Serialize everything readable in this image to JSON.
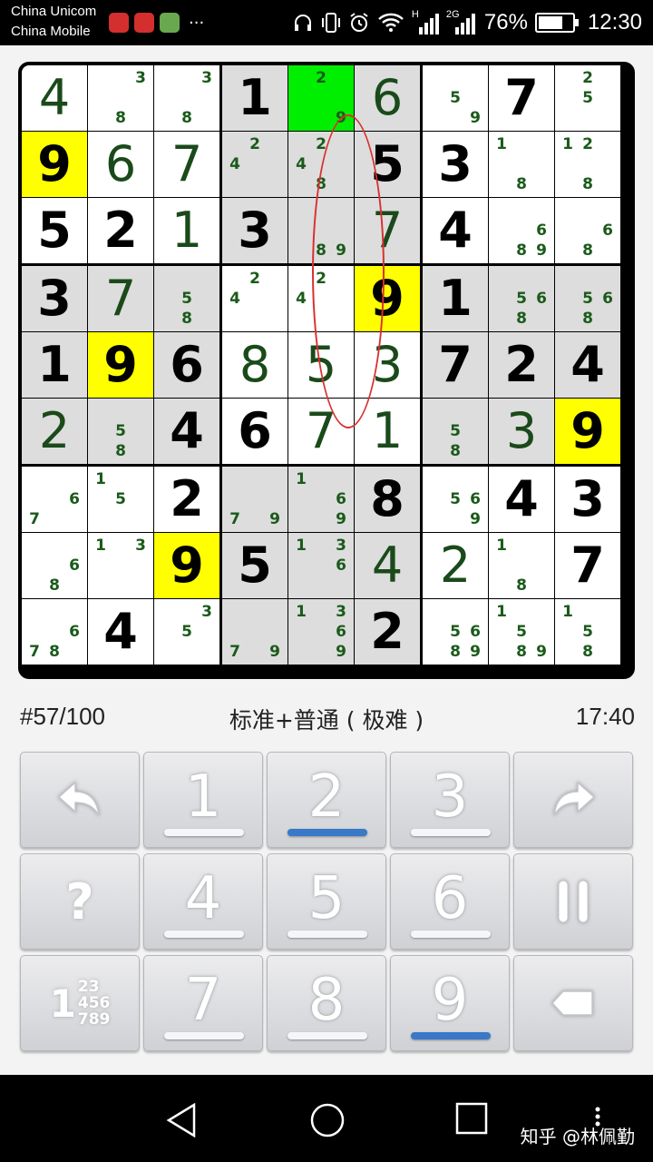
{
  "status_bar": {
    "carrier1": "China Unicom",
    "carrier2": "China Mobile",
    "more": "···",
    "network_type": "H",
    "network_type2": "2G",
    "battery": "76%",
    "time": "12:30"
  },
  "board": {
    "highlight_colors": {
      "gray": "#dddddd",
      "white": "#ffffff",
      "yellow": "#ffff00",
      "green": "#00ee00"
    },
    "cells": [
      [
        {
          "v": "4",
          "k": "user",
          "bg": "white"
        },
        {
          "c": "38",
          "bg": "white"
        },
        {
          "c": "38",
          "bg": "white"
        },
        {
          "v": "1",
          "k": "given",
          "bg": "gray"
        },
        {
          "c": "29",
          "bg": "green"
        },
        {
          "v": "6",
          "k": "user",
          "bg": "gray"
        },
        {
          "c": "59",
          "bg": "white"
        },
        {
          "v": "7",
          "k": "given",
          "bg": "white"
        },
        {
          "c": "25",
          "bg": "white"
        }
      ],
      [
        {
          "v": "9",
          "k": "given",
          "bg": "yellow"
        },
        {
          "v": "6",
          "k": "user",
          "bg": "white"
        },
        {
          "v": "7",
          "k": "user",
          "bg": "white"
        },
        {
          "c": "24",
          "bg": "gray"
        },
        {
          "c": "248",
          "bg": "gray"
        },
        {
          "v": "5",
          "k": "given",
          "bg": "gray"
        },
        {
          "v": "3",
          "k": "given",
          "bg": "white"
        },
        {
          "c": "18",
          "bg": "white"
        },
        {
          "c": "128",
          "bg": "white"
        }
      ],
      [
        {
          "v": "5",
          "k": "given",
          "bg": "white"
        },
        {
          "v": "2",
          "k": "given",
          "bg": "white"
        },
        {
          "v": "1",
          "k": "user",
          "bg": "white"
        },
        {
          "v": "3",
          "k": "given",
          "bg": "gray"
        },
        {
          "c": "89",
          "bg": "gray"
        },
        {
          "v": "7",
          "k": "user",
          "bg": "gray"
        },
        {
          "v": "4",
          "k": "given",
          "bg": "white"
        },
        {
          "c": "689",
          "bg": "white"
        },
        {
          "c": "68",
          "bg": "white"
        }
      ],
      [
        {
          "v": "3",
          "k": "given",
          "bg": "gray"
        },
        {
          "v": "7",
          "k": "user",
          "bg": "gray"
        },
        {
          "c": "58",
          "bg": "gray"
        },
        {
          "c": "24",
          "bg": "white"
        },
        {
          "c": "24",
          "bg": "white"
        },
        {
          "v": "9",
          "k": "given",
          "bg": "yellow"
        },
        {
          "v": "1",
          "k": "given",
          "bg": "gray"
        },
        {
          "c": "568",
          "bg": "gray"
        },
        {
          "c": "568",
          "bg": "gray"
        }
      ],
      [
        {
          "v": "1",
          "k": "given",
          "bg": "gray"
        },
        {
          "v": "9",
          "k": "given",
          "bg": "yellow"
        },
        {
          "v": "6",
          "k": "given",
          "bg": "gray"
        },
        {
          "v": "8",
          "k": "user",
          "bg": "white"
        },
        {
          "v": "5",
          "k": "user",
          "bg": "white"
        },
        {
          "v": "3",
          "k": "user",
          "bg": "white"
        },
        {
          "v": "7",
          "k": "given",
          "bg": "gray"
        },
        {
          "v": "2",
          "k": "given",
          "bg": "gray"
        },
        {
          "v": "4",
          "k": "given",
          "bg": "gray"
        }
      ],
      [
        {
          "v": "2",
          "k": "user",
          "bg": "gray"
        },
        {
          "c": "58",
          "bg": "gray"
        },
        {
          "v": "4",
          "k": "given",
          "bg": "gray"
        },
        {
          "v": "6",
          "k": "given",
          "bg": "white"
        },
        {
          "v": "7",
          "k": "user",
          "bg": "white"
        },
        {
          "v": "1",
          "k": "user",
          "bg": "white"
        },
        {
          "c": "58",
          "bg": "gray"
        },
        {
          "v": "3",
          "k": "user",
          "bg": "gray"
        },
        {
          "v": "9",
          "k": "given",
          "bg": "yellow"
        }
      ],
      [
        {
          "c": "67",
          "bg": "white"
        },
        {
          "c": "15",
          "bg": "white"
        },
        {
          "v": "2",
          "k": "given",
          "bg": "white"
        },
        {
          "c": "79",
          "bg": "gray"
        },
        {
          "c": "169",
          "bg": "gray"
        },
        {
          "v": "8",
          "k": "given",
          "bg": "gray"
        },
        {
          "c": "569",
          "bg": "white"
        },
        {
          "v": "4",
          "k": "given",
          "bg": "white"
        },
        {
          "v": "3",
          "k": "given",
          "bg": "white"
        }
      ],
      [
        {
          "c": "68",
          "bg": "white"
        },
        {
          "c": "13",
          "bg": "white"
        },
        {
          "v": "9",
          "k": "given",
          "bg": "yellow"
        },
        {
          "v": "5",
          "k": "given",
          "bg": "gray"
        },
        {
          "c": "136",
          "bg": "gray"
        },
        {
          "v": "4",
          "k": "user",
          "bg": "gray"
        },
        {
          "v": "2",
          "k": "user",
          "bg": "white"
        },
        {
          "c": "18",
          "bg": "white"
        },
        {
          "v": "7",
          "k": "given",
          "bg": "white"
        }
      ],
      [
        {
          "c": "678",
          "bg": "white"
        },
        {
          "v": "4",
          "k": "given",
          "bg": "white"
        },
        {
          "c": "35",
          "bg": "white"
        },
        {
          "c": "79",
          "bg": "gray"
        },
        {
          "c": "1369",
          "bg": "gray"
        },
        {
          "v": "2",
          "k": "given",
          "bg": "gray"
        },
        {
          "c": "5689",
          "bg": "white"
        },
        {
          "c": "1589",
          "bg": "white"
        },
        {
          "c": "158",
          "bg": "white"
        }
      ]
    ]
  },
  "info": {
    "puzzle_id": "#57/100",
    "mode": "标准+普通 ( 极难 )",
    "timer": "17:40"
  },
  "keypad": {
    "undo_icon": "undo-arrow-icon",
    "redo_icon": "redo-arrow-icon",
    "hint_label": "?",
    "pause_icon": "pause-icon",
    "notes_icon": "pencil-notes-icon",
    "notes_label_1": "1",
    "notes_label_2": "23",
    "notes_label_3": "456",
    "notes_label_4": "789",
    "erase_icon": "eraser-icon",
    "numbers": [
      {
        "label": "1",
        "selected": false
      },
      {
        "label": "2",
        "selected": true
      },
      {
        "label": "3",
        "selected": false
      },
      {
        "label": "4",
        "selected": false
      },
      {
        "label": "5",
        "selected": false
      },
      {
        "label": "6",
        "selected": false
      },
      {
        "label": "7",
        "selected": false
      },
      {
        "label": "8",
        "selected": false
      },
      {
        "label": "9",
        "selected": true
      }
    ]
  },
  "nav": {
    "watermark": "知乎 @林佩勤"
  }
}
